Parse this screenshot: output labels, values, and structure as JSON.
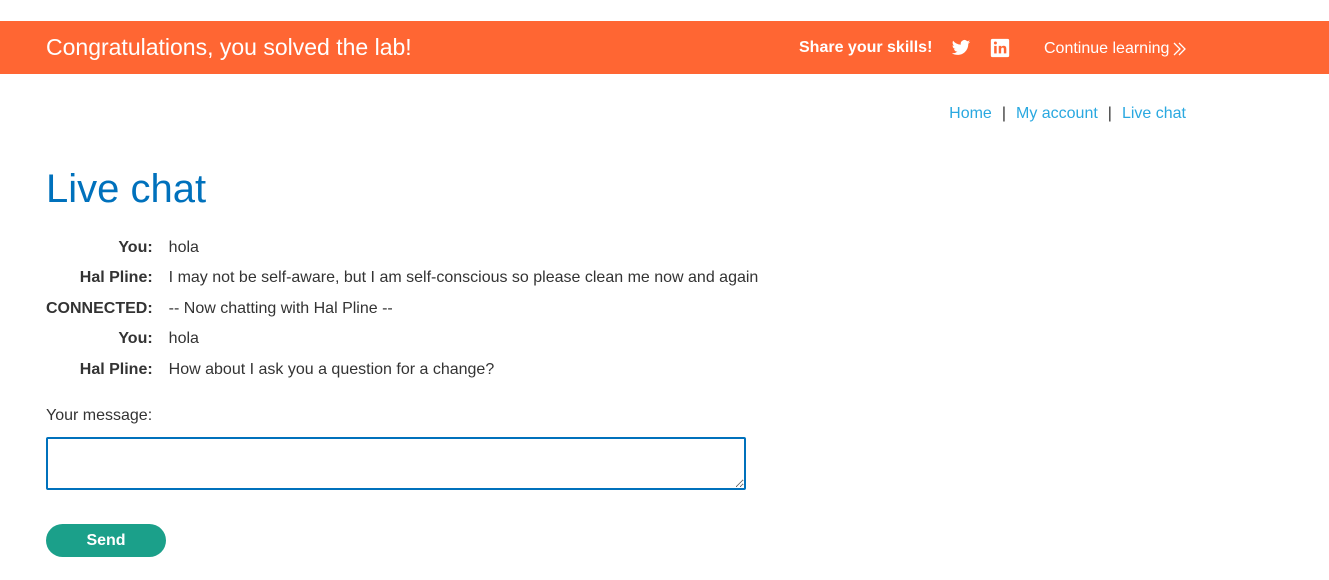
{
  "banner": {
    "title": "Congratulations, you solved the lab!",
    "share_label": "Share your skills!",
    "twitter_icon": "twitter-icon",
    "linkedin_icon": "linkedin-icon",
    "continue_label": "Continue learning",
    "background_color": "#ff6633"
  },
  "nav": {
    "items": [
      {
        "label": "Home"
      },
      {
        "label": "My account"
      },
      {
        "label": "Live chat"
      }
    ],
    "separator": "|"
  },
  "page": {
    "title": "Live chat"
  },
  "chat": {
    "messages": [
      {
        "who": "You:",
        "text": "hola"
      },
      {
        "who": "Hal Pline:",
        "text": "I may not be self-aware, but I am self-conscious so please clean me now and again"
      },
      {
        "who": "CONNECTED:",
        "text": "-- Now chatting with Hal Pline --"
      },
      {
        "who": "You:",
        "text": "hola"
      },
      {
        "who": "Hal Pline:",
        "text": "How about I ask you a question for a change?"
      }
    ]
  },
  "form": {
    "message_label": "Your message:",
    "message_value": "",
    "send_label": "Send"
  }
}
